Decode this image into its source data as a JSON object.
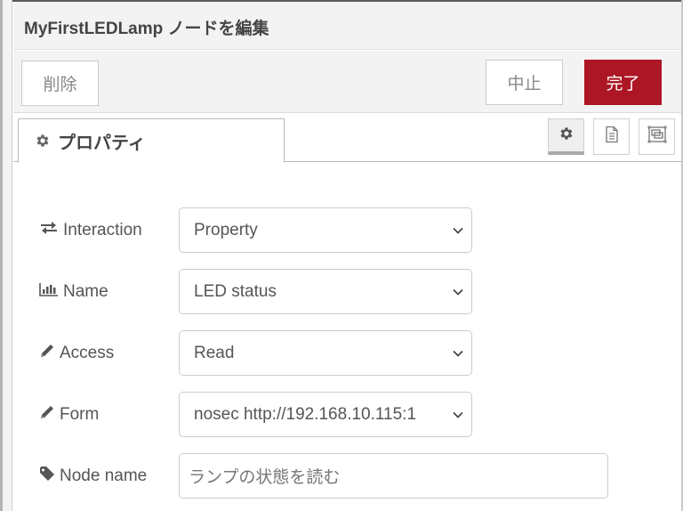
{
  "tray": {
    "title": "MyFirstLEDLamp ノードを編集"
  },
  "toolbar": {
    "delete_label": "削除",
    "cancel_label": "中止",
    "done_label": "完了",
    "done_color": "#ad1625"
  },
  "tabs": [
    {
      "label": "プロパティ",
      "icon": "gear-icon",
      "active": true
    }
  ],
  "side_buttons": [
    {
      "icon": "gear-icon",
      "active": true
    },
    {
      "icon": "document-icon",
      "active": false
    },
    {
      "icon": "frame-icon",
      "active": false
    }
  ],
  "form": {
    "rows": [
      {
        "label": "Interaction",
        "icon": "exchange-icon",
        "type": "select",
        "value": "Property"
      },
      {
        "label": "Name",
        "icon": "bar-chart-icon",
        "type": "select",
        "value": "LED status"
      },
      {
        "label": "Access",
        "icon": "pencil-icon",
        "type": "select",
        "value": "Read"
      },
      {
        "label": "Form",
        "icon": "pencil-icon",
        "type": "select",
        "value": "nosec http://192.168.10.115:1"
      },
      {
        "label": "Node name",
        "icon": "tag-icon",
        "type": "input",
        "value": "ランプの状態を読む"
      }
    ]
  }
}
